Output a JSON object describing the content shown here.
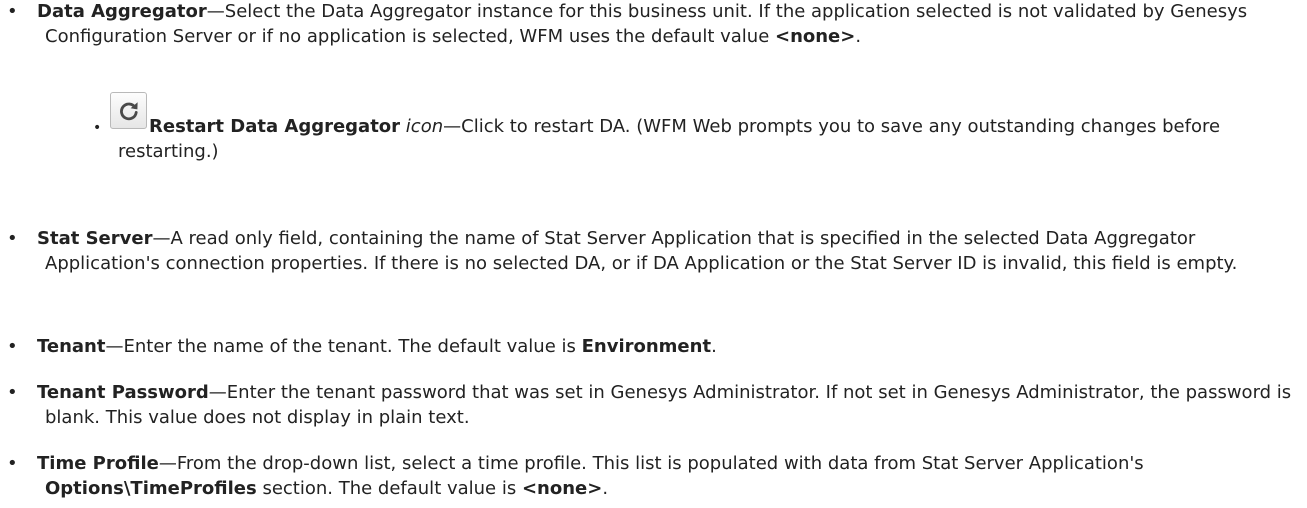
{
  "items": {
    "data_aggregator": {
      "term": "Data Aggregator",
      "desc_1": "—Select the Data Aggregator instance for this business unit. If the application selected is not validated by Genesys Configuration Server or if no application is selected, WFM uses the default value ",
      "default_value": "<none>",
      "desc_2": "."
    },
    "restart": {
      "icon": "refresh-icon",
      "term": "Restart Data Aggregator",
      "icon_word": "icon",
      "desc": "—Click to restart DA. (WFM Web prompts you to save any outstanding changes before restarting.)"
    },
    "stat_server": {
      "term": "Stat Server",
      "desc": "—A read only field, containing the name of Stat Server Application that is specified in the selected Data Aggregator Application's connection properties. If there is no selected DA, or if DA Application or the Stat Server ID is invalid, this field is empty."
    },
    "tenant": {
      "term": "Tenant",
      "desc_1": "—Enter the name of the tenant. The default value is ",
      "default_value": "Environment",
      "desc_2": "."
    },
    "tenant_password": {
      "term": "Tenant Password",
      "desc": "—Enter the tenant password that was set in Genesys Administrator. If not set in Genesys Administrator, the password is blank. This value does not display in plain text."
    },
    "time_profile": {
      "term": "Time Profile",
      "desc_1": "—From the drop-down list, select a time profile. This list is populated with data from Stat Server Application's ",
      "section": "Options\\TimeProfiles",
      "desc_2": " section. The default value is ",
      "default_value": "<none>",
      "desc_3": "."
    }
  }
}
